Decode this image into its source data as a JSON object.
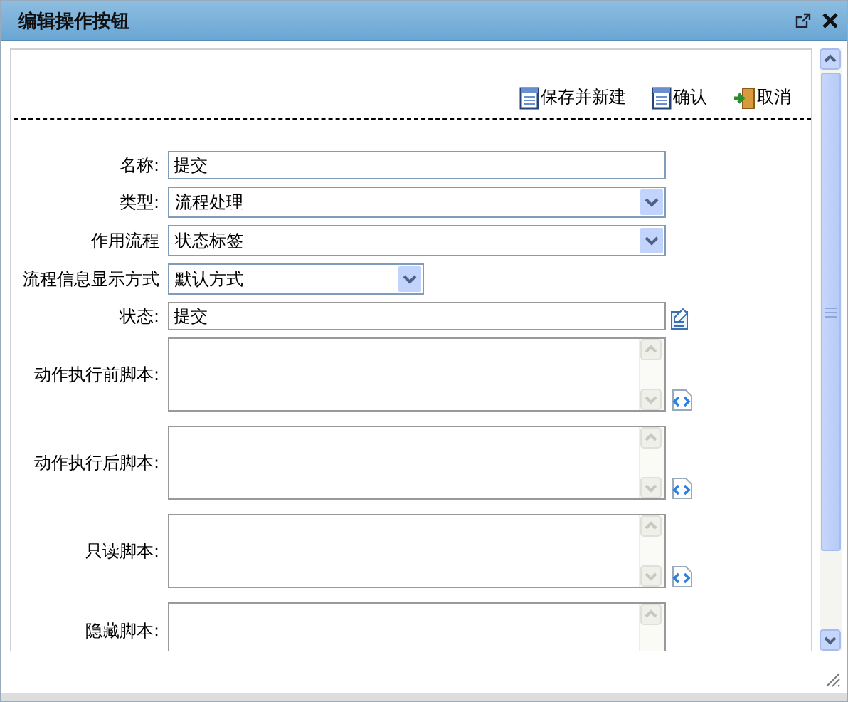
{
  "window": {
    "title": "编辑操作按钮"
  },
  "toolbar": [
    {
      "kind": "save",
      "label": "保存并新建"
    },
    {
      "kind": "save",
      "label": "确认"
    },
    {
      "kind": "exit",
      "label": "取消"
    }
  ],
  "fields": [
    {
      "kind": "text",
      "label": "名称:",
      "value": "提交"
    },
    {
      "kind": "select",
      "label": "类型:",
      "value": "流程处理"
    },
    {
      "kind": "select",
      "label": "作用流程",
      "value": "状态标签"
    },
    {
      "kind": "combobox",
      "label": "流程信息显示方式",
      "value": "默认方式"
    },
    {
      "kind": "picker",
      "label": "状态:",
      "value": "提交"
    },
    {
      "kind": "script",
      "label": "动作执行前脚本:"
    },
    {
      "kind": "script",
      "label": "动作执行后脚本:"
    },
    {
      "kind": "script",
      "label": "只读脚本:"
    },
    {
      "kind": "script-cut",
      "label": "隐藏脚本:"
    }
  ]
}
